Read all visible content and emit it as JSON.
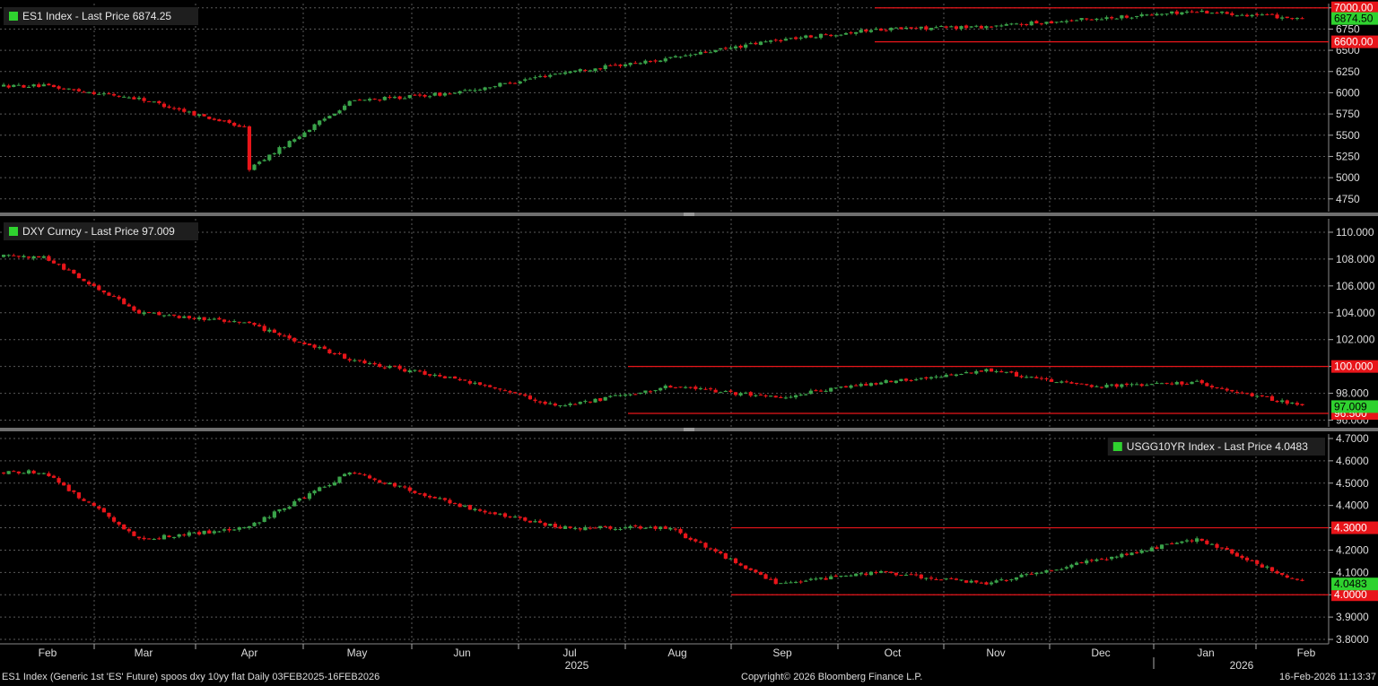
{
  "colors": {
    "background": "#000000",
    "up": "#3aa34a",
    "down": "#e8151a",
    "level_line": "#e8151a",
    "grid": "#5a5a5a",
    "axis_text": "#dcdcdc",
    "legend_bg": "#1e1e1e",
    "legend_square": "#2fd22f",
    "last_price_box": "#2fd22f",
    "separator": "#6e6e6e"
  },
  "footer": {
    "left": "ES1 Index (Generic 1st 'ES' Future) spoos dxy 10yy flat Daily 03FEB2025-16FEB2026",
    "center": "Copyright© 2026 Bloomberg Finance L.P.",
    "right": "16-Feb-2026 11:13:37"
  },
  "x_axis": {
    "months": [
      "Feb",
      "Mar",
      "Apr",
      "May",
      "Jun",
      "Jul",
      "Aug",
      "Sep",
      "Oct",
      "Nov",
      "Dec",
      "Jan",
      "Feb"
    ],
    "years": [
      "2025",
      "2026"
    ]
  },
  "chart_data": [
    {
      "type": "candlestick",
      "legend": "ES1 Index - Last Price 6874.25",
      "ylim": [
        4600,
        7050
      ],
      "yticks": [
        "7000",
        "6750",
        "6500",
        "6250",
        "6000",
        "5750",
        "5500",
        "5250",
        "5000",
        "4750"
      ],
      "last_price": "6874.50",
      "levels": [
        {
          "value": 7000,
          "label": "7000.00"
        },
        {
          "value": 6600,
          "label": "6600.00"
        }
      ],
      "x": [
        "2025-02",
        "2025-03",
        "2025-04",
        "2025-04-08",
        "2025-04-21",
        "2025-05",
        "2025-06",
        "2025-07",
        "2025-08",
        "2025-09",
        "2025-10",
        "2025-11",
        "2025-12",
        "2026-01",
        "2026-02"
      ],
      "values": [
        6080,
        5930,
        5580,
        4900,
        5250,
        5900,
        6000,
        6240,
        6400,
        6620,
        6750,
        6780,
        6870,
        6960,
        6874.5
      ]
    },
    {
      "type": "candlestick",
      "legend": "DXY Curncy - Last Price 97.009",
      "ylim": [
        95.5,
        111
      ],
      "yticks": [
        "110.000",
        "108.000",
        "106.000",
        "104.000",
        "102.000",
        "100.000",
        "98.000",
        "96.000"
      ],
      "last_price": "97.009",
      "levels": [
        {
          "value": 100,
          "label": "100.000"
        },
        {
          "value": 96.5,
          "label": "96.500"
        }
      ],
      "x": [
        "2025-02",
        "2025-03",
        "2025-04",
        "2025-05",
        "2025-06",
        "2025-07",
        "2025-08",
        "2025-09",
        "2025-10",
        "2025-11",
        "2025-12",
        "2026-01",
        "2026-02"
      ],
      "values": [
        108.2,
        104.0,
        103.2,
        100.5,
        99.0,
        97.0,
        98.5,
        97.7,
        98.8,
        99.7,
        98.5,
        98.8,
        97.0
      ]
    },
    {
      "type": "candlestick",
      "legend": "USGG10YR Index - Last Price 4.0483",
      "ylim": [
        3.78,
        4.72
      ],
      "yticks": [
        "4.7000",
        "4.6000",
        "4.5000",
        "4.4000",
        "4.3000",
        "4.2000",
        "4.1000",
        "4.0000",
        "3.9000",
        "3.8000"
      ],
      "last_price": "4.0483",
      "levels": [
        {
          "value": 4.3,
          "label": "4.3000"
        },
        {
          "value": 4.0,
          "label": "4.0000"
        }
      ],
      "x": [
        "2025-02",
        "2025-03",
        "2025-04",
        "2025-05",
        "2025-06",
        "2025-07",
        "2025-08",
        "2025-09",
        "2025-10",
        "2025-11",
        "2025-12",
        "2026-01",
        "2026-02"
      ],
      "values": [
        4.55,
        4.25,
        4.3,
        4.55,
        4.4,
        4.3,
        4.3,
        4.05,
        4.1,
        4.05,
        4.15,
        4.25,
        4.05
      ]
    }
  ]
}
